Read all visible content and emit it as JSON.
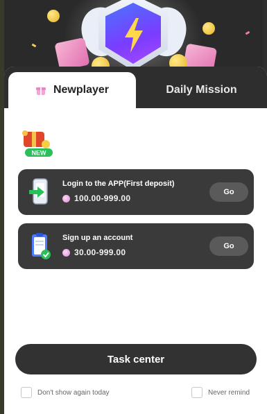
{
  "tabs": [
    {
      "label": "Newplayer",
      "active": true,
      "icon": "gift-icon"
    },
    {
      "label": "Daily Mission",
      "active": false
    }
  ],
  "new_badge": {
    "label": "NEW"
  },
  "tasks": [
    {
      "title": "Login to the APP(First deposit)",
      "reward": "100.00-999.00",
      "action": "Go",
      "icon": "phone-login-icon"
    },
    {
      "title": "Sign up an account",
      "reward": "30.00-999.00",
      "action": "Go",
      "icon": "clipboard-check-icon"
    }
  ],
  "primary_button": "Task center",
  "options": {
    "dont_show_today": "Don't show again today",
    "never_remind": "Never remind"
  },
  "colors": {
    "card_bg": "#ffffff",
    "task_bg": "#3a3a3a",
    "button_dark": "#323232",
    "go_button": "#5a5a5a",
    "accent_green": "#2bbf5a",
    "badge_purple": "#7a3cff"
  }
}
